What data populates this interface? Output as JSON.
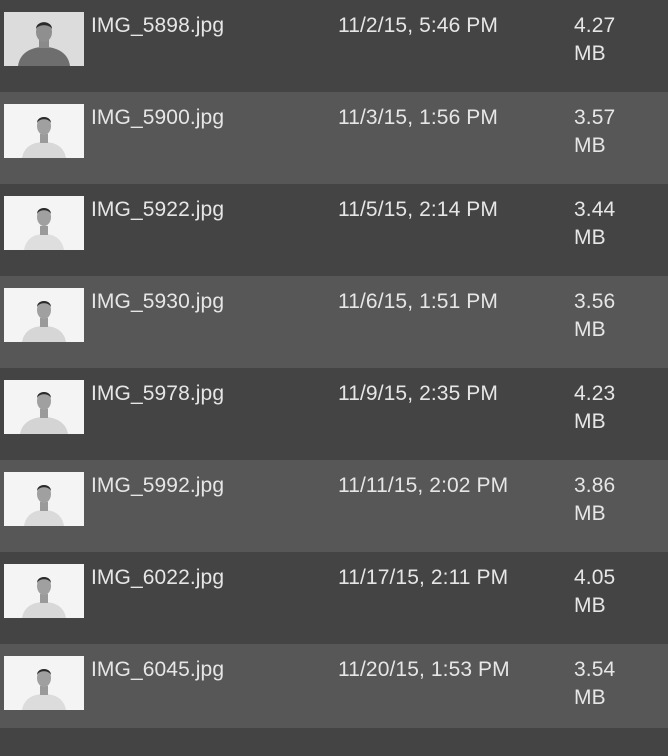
{
  "files": [
    {
      "name": "IMG_5898.jpg",
      "modified": "11/2/15, 5:46 PM",
      "size_value": "4.27",
      "size_unit": "MB",
      "thumbnail": "portrait-photo-thumbnail"
    },
    {
      "name": "IMG_5900.jpg",
      "modified": "11/3/15, 1:56 PM",
      "size_value": "3.57",
      "size_unit": "MB",
      "thumbnail": "portrait-photo-thumbnail"
    },
    {
      "name": "IMG_5922.jpg",
      "modified": "11/5/15, 2:14 PM",
      "size_value": "3.44",
      "size_unit": "MB",
      "thumbnail": "portrait-photo-thumbnail"
    },
    {
      "name": "IMG_5930.jpg",
      "modified": "11/6/15, 1:51 PM",
      "size_value": "3.56",
      "size_unit": "MB",
      "thumbnail": "portrait-photo-thumbnail"
    },
    {
      "name": "IMG_5978.jpg",
      "modified": "11/9/15, 2:35 PM",
      "size_value": "4.23",
      "size_unit": "MB",
      "thumbnail": "portrait-photo-thumbnail"
    },
    {
      "name": "IMG_5992.jpg",
      "modified": "11/11/15, 2:02 PM",
      "size_value": "3.86",
      "size_unit": "MB",
      "thumbnail": "portrait-photo-thumbnail"
    },
    {
      "name": "IMG_6022.jpg",
      "modified": "11/17/15, 2:11 PM",
      "size_value": "4.05",
      "size_unit": "MB",
      "thumbnail": "portrait-photo-thumbnail"
    },
    {
      "name": "IMG_6045.jpg",
      "modified": "11/20/15, 1:53 PM",
      "size_value": "3.54",
      "size_unit": "MB",
      "thumbnail": "portrait-photo-thumbnail"
    }
  ],
  "colors": {
    "row_dark": "#444444",
    "row_light": "#575757",
    "text": "#e6e6e6"
  }
}
